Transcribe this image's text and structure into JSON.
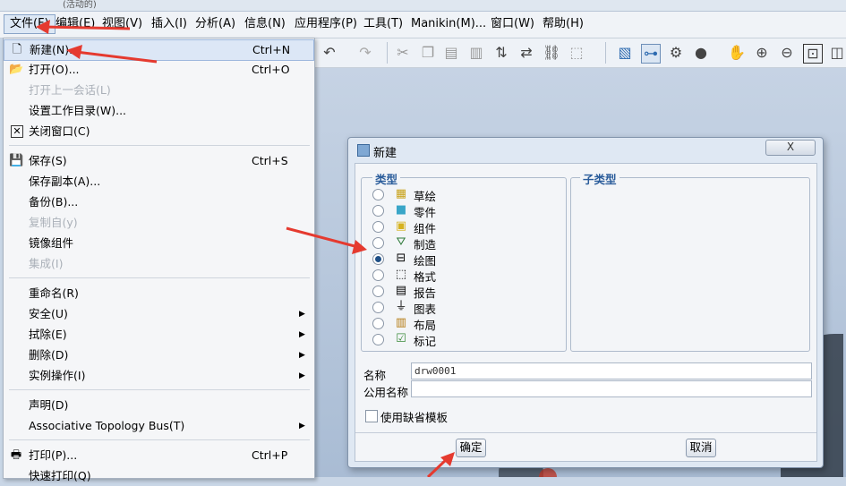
{
  "window": {
    "title_fragment": "(活动的)"
  },
  "menubar": {
    "items": [
      "文件(F)",
      "编辑(E)",
      "视图(V)",
      "插入(I)",
      "分析(A)",
      "信息(N)",
      "应用程序(P)",
      "工具(T)",
      "Manikin(M)...",
      "窗口(W)",
      "帮助(H)"
    ]
  },
  "file_menu": {
    "items": [
      {
        "label": "新建(N)...",
        "shortcut": "Ctrl+N",
        "icon": "new-file-icon",
        "disabled": false
      },
      {
        "label": "打开(O)...",
        "shortcut": "Ctrl+O",
        "icon": "open-folder-icon",
        "disabled": false
      },
      {
        "label": "打开上一会话(L)",
        "shortcut": "",
        "icon": "",
        "disabled": true
      },
      {
        "label": "设置工作目录(W)...",
        "shortcut": "",
        "icon": "",
        "disabled": false
      },
      {
        "label": "关闭窗口(C)",
        "shortcut": "",
        "icon": "close-window-icon",
        "disabled": false
      },
      {
        "label": "保存(S)",
        "shortcut": "Ctrl+S",
        "icon": "save-icon",
        "disabled": false
      },
      {
        "label": "保存副本(A)...",
        "shortcut": "",
        "icon": "",
        "disabled": false
      },
      {
        "label": "备份(B)...",
        "shortcut": "",
        "icon": "",
        "disabled": false
      },
      {
        "label": "复制自(y)",
        "shortcut": "",
        "icon": "",
        "disabled": true
      },
      {
        "label": "镜像组件",
        "shortcut": "",
        "icon": "",
        "disabled": false
      },
      {
        "label": "集成(I)",
        "shortcut": "",
        "icon": "",
        "disabled": true
      },
      {
        "label": "重命名(R)",
        "shortcut": "",
        "icon": "",
        "disabled": false
      },
      {
        "label": "安全(U)",
        "shortcut": "",
        "icon": "",
        "disabled": false,
        "submenu": true
      },
      {
        "label": "拭除(E)",
        "shortcut": "",
        "icon": "",
        "disabled": false,
        "submenu": true
      },
      {
        "label": "删除(D)",
        "shortcut": "",
        "icon": "",
        "disabled": false,
        "submenu": true
      },
      {
        "label": "实例操作(I)",
        "shortcut": "",
        "icon": "",
        "disabled": false,
        "submenu": true
      },
      {
        "label": "声明(D)",
        "shortcut": "",
        "icon": "",
        "disabled": false
      },
      {
        "label": "Associative Topology Bus(T)",
        "shortcut": "",
        "icon": "",
        "disabled": false,
        "submenu": true
      },
      {
        "label": "打印(P)...",
        "shortcut": "Ctrl+P",
        "icon": "print-icon",
        "disabled": false
      },
      {
        "label": "快速打印(Q)",
        "shortcut": "",
        "icon": "",
        "disabled": false
      }
    ]
  },
  "dialog": {
    "title": "新建",
    "close_label": "X",
    "type_group_title": "类型",
    "subtype_group_title": "子类型",
    "types": [
      {
        "label": "草绘",
        "icon": "sketch-icon",
        "selected": false
      },
      {
        "label": "零件",
        "icon": "part-icon",
        "selected": false
      },
      {
        "label": "组件",
        "icon": "assembly-icon",
        "selected": false
      },
      {
        "label": "制造",
        "icon": "manufacturing-icon",
        "selected": false
      },
      {
        "label": "绘图",
        "icon": "drawing-icon",
        "selected": true
      },
      {
        "label": "格式",
        "icon": "format-icon",
        "selected": false
      },
      {
        "label": "报告",
        "icon": "report-icon",
        "selected": false
      },
      {
        "label": "图表",
        "icon": "diagram-icon",
        "selected": false
      },
      {
        "label": "布局",
        "icon": "layout-icon",
        "selected": false
      },
      {
        "label": "标记",
        "icon": "markup-icon",
        "selected": false
      }
    ],
    "name_label": "名称",
    "name_value": "drw0001",
    "common_name_label": "公用名称",
    "common_name_value": "",
    "use_default_template_label": "使用缺省模板",
    "use_default_template_checked": false,
    "ok_label": "确定",
    "cancel_label": "取消"
  },
  "annotations": {
    "arrow_color": "#e53a2f"
  }
}
